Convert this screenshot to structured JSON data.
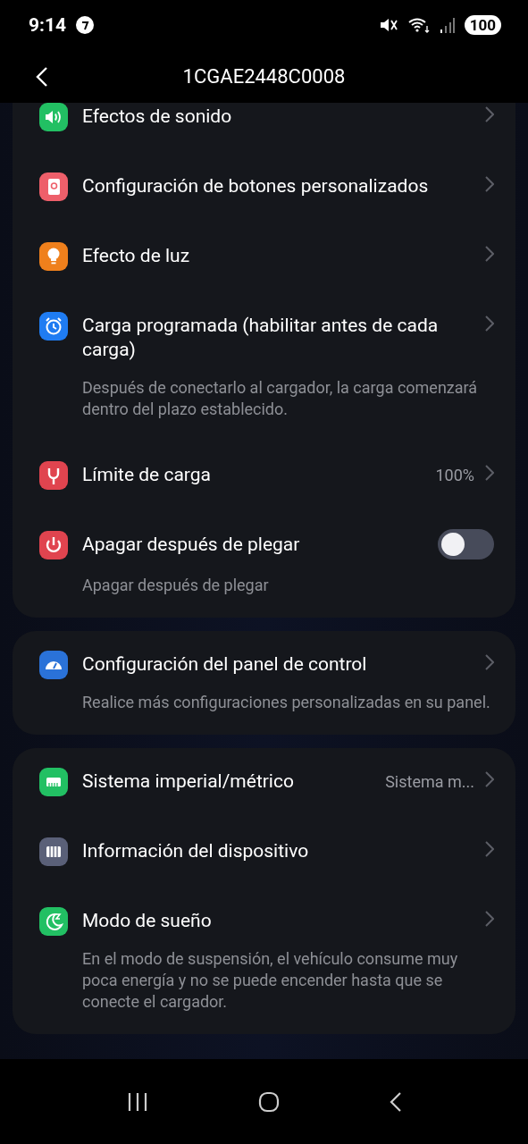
{
  "status_bar": {
    "time": "9:14",
    "battery": "100"
  },
  "header": {
    "title": "1CGAE2448C0008"
  },
  "cards": [
    {
      "rows": [
        {
          "kind": "link",
          "color": "#22c063",
          "title": "Efectos de sonido"
        },
        {
          "kind": "link",
          "color": "#ee5f6a",
          "title": "Configuración de botones personalizados"
        },
        {
          "kind": "link",
          "color": "#ef801c",
          "title": "Efecto de luz"
        },
        {
          "kind": "link",
          "color": "#1f7cf2",
          "title": "Carga programada (habilitar antes de cada carga)",
          "description": "Después de conectarlo al cargador, la carga comenzará dentro del plazo establecido."
        },
        {
          "kind": "link",
          "color": "#e0444f",
          "title": "Límite de carga",
          "value": "100%"
        },
        {
          "kind": "toggle",
          "color": "#e0444f",
          "title": "Apagar después de plegar",
          "on": false,
          "description": "Apagar después de plegar"
        }
      ]
    },
    {
      "rows": [
        {
          "kind": "link",
          "color": "#2a72d8",
          "title": "Configuración del panel de control",
          "description": "Realice más configuraciones personalizadas en su panel."
        }
      ]
    },
    {
      "rows": [
        {
          "kind": "link",
          "color": "#22c063",
          "title": "Sistema imperial/métrico",
          "value": "Sistema m..."
        },
        {
          "kind": "link",
          "color": "#5a6078",
          "title": "Información del dispositivo"
        },
        {
          "kind": "link",
          "color": "#22c063",
          "title": "Modo de sueño",
          "description": "En el modo de suspensión, el vehículo consume muy poca energía y no se puede encender hasta que se conecte el cargador."
        }
      ]
    }
  ]
}
